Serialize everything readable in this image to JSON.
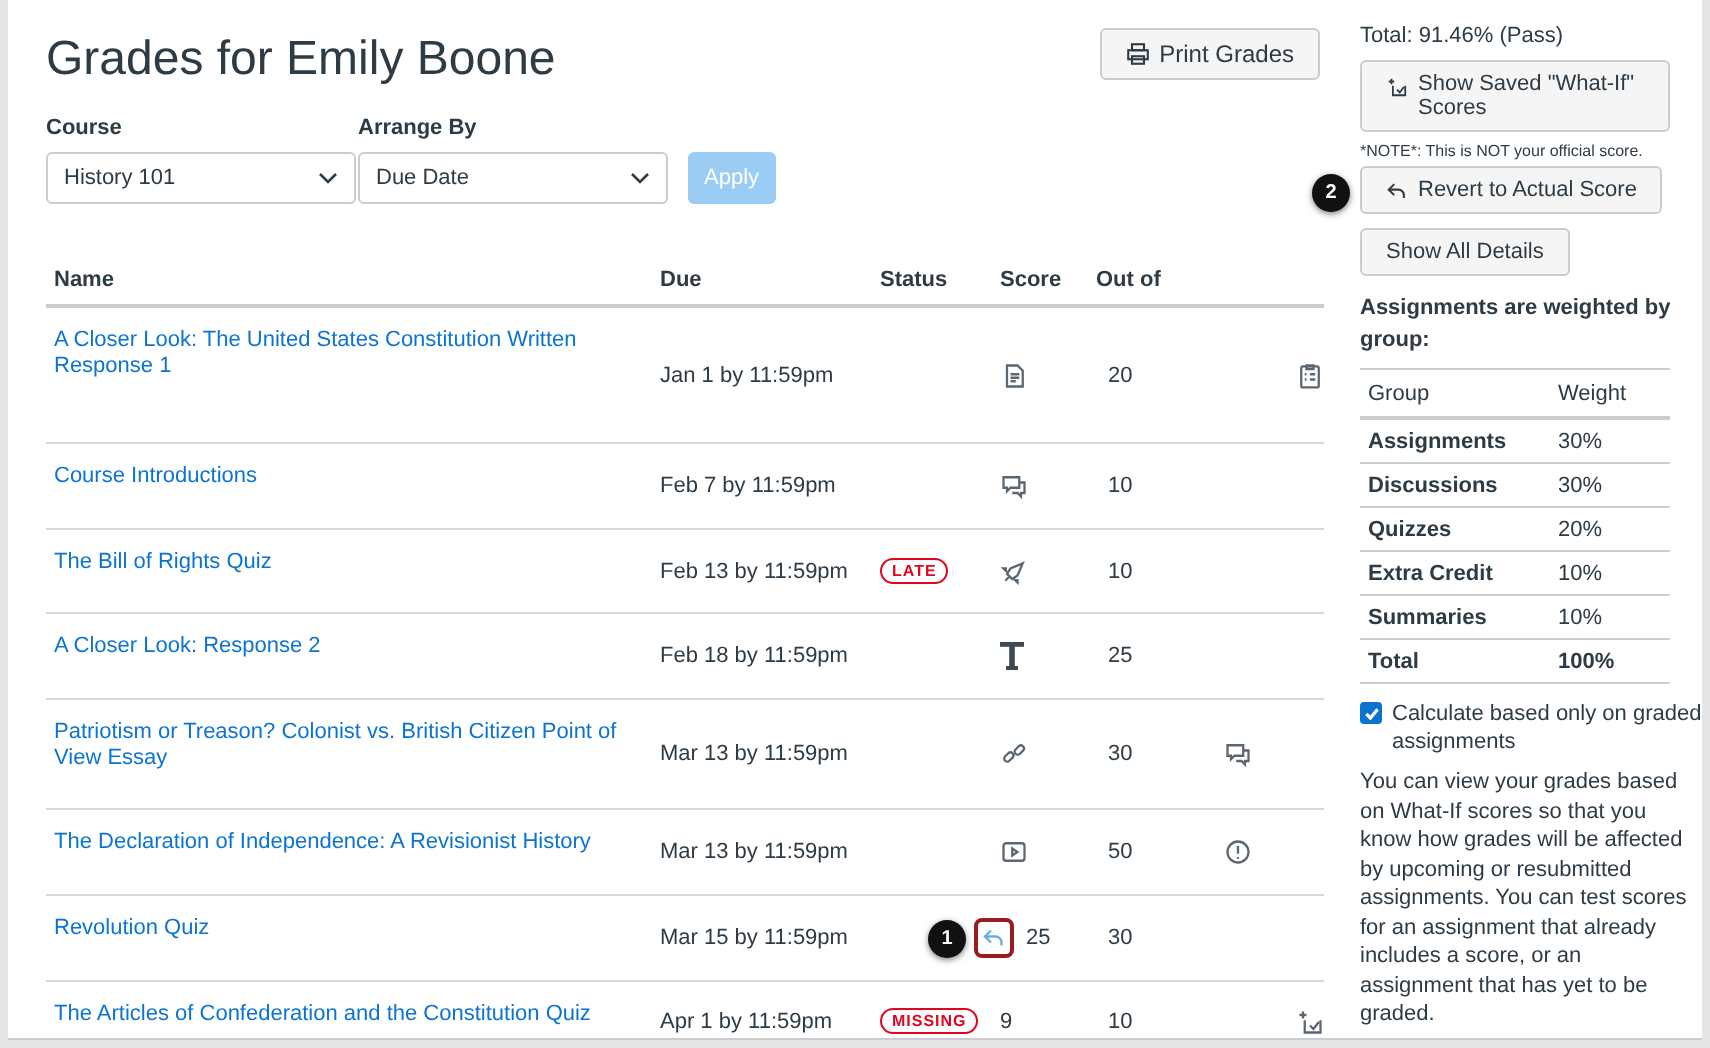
{
  "title": "Grades for Emily Boone",
  "print_button": "Print Grades",
  "filters": [
    {
      "label": "Course",
      "value": "History 101"
    },
    {
      "label": "Arrange By",
      "value": "Due Date"
    }
  ],
  "apply_button": {
    "label": "Apply",
    "disabled": true
  },
  "table": {
    "columns": [
      "Name",
      "Due",
      "Status",
      "Score",
      "Out of"
    ],
    "rows": [
      {
        "name": "A Closer Look: The United States Constitution Written Response 1",
        "due": "Jan 1 by 11:59pm",
        "score": {
          "kind": "document"
        },
        "out_of": "20",
        "extra": {
          "kind": "clipboard"
        }
      },
      {
        "name": "Course Introductions",
        "due": "Feb 7 by 11:59pm",
        "score": {
          "kind": "discussion"
        },
        "out_of": "10"
      },
      {
        "name": "The Bill of Rights Quiz",
        "due": "Feb 13 by 11:59pm",
        "status": "LATE",
        "score": {
          "kind": "rocket"
        },
        "out_of": "10"
      },
      {
        "name": "A Closer Look: Response 2",
        "due": "Feb 18 by 11:59pm",
        "score": {
          "kind": "text"
        },
        "out_of": "25"
      },
      {
        "name": "Patriotism or Treason? Colonist vs. British Citizen Point of View Essay",
        "due": "Mar 13 by 11:59pm",
        "score": {
          "kind": "link"
        },
        "out_of": "30",
        "extra": {
          "kind": "discussion"
        }
      },
      {
        "name": "The Declaration of Independence: A Revisionist History",
        "due": "Mar 13 by 11:59pm",
        "score": {
          "kind": "media"
        },
        "out_of": "50",
        "extra": {
          "kind": "alert"
        }
      },
      {
        "name": "Revolution Quiz",
        "due": "Mar 15 by 11:59pm",
        "score": {
          "kind": "revert",
          "text": "25",
          "callout": "1"
        },
        "out_of": "30"
      },
      {
        "name": "The Articles of Confederation and the Constitution Quiz",
        "due": "Apr 1 by 11:59pm",
        "status": "MISSING",
        "score": {
          "kind": "number",
          "text": "9"
        },
        "out_of": "10",
        "extra": {
          "kind": "whatif"
        }
      }
    ]
  },
  "sidebar": {
    "total": "Total: 91.46% (Pass)",
    "saved_button": "Show Saved \"What-If\" Scores",
    "note": "*NOTE*: This is NOT your official score.",
    "revert_button": "Revert to Actual Score",
    "revert_callout": "2",
    "details_button": "Show All Details",
    "weights_heading": "Assignments are weighted by group:",
    "weights": {
      "columns": [
        "Group",
        "Weight"
      ],
      "rows": [
        {
          "group": "Assignments",
          "weight": "30%",
          "total": false
        },
        {
          "group": "Discussions",
          "weight": "30%",
          "total": false
        },
        {
          "group": "Quizzes",
          "weight": "20%",
          "total": false
        },
        {
          "group": "Extra Credit",
          "weight": "10%",
          "total": false
        },
        {
          "group": "Summaries",
          "weight": "10%",
          "total": false
        },
        {
          "group": "Total",
          "weight": "100%",
          "total": true
        }
      ]
    },
    "checkbox": {
      "label": "Calculate based only on graded assignments",
      "checked": true
    },
    "info": "You can view your grades based on What-If scores so that you know how grades will be affected by upcoming or resubmitted assignments. You can test scores for an assignment that already includes a score, or an assignment that has yet to be graded."
  }
}
